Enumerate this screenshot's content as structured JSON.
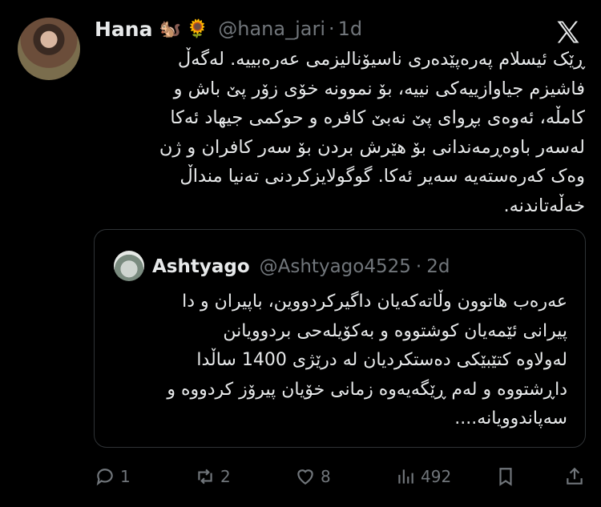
{
  "author": {
    "name": "Hana",
    "emojis": "🐿️ 🌻",
    "handle": "@hana_jari",
    "separator": "·",
    "time": "1d"
  },
  "tweet_lines": [
    "ڕێک ئیسلام پەرەپێدەری ناسیۆنالیزمی عەرەبییە. لەگەڵ",
    "فاشیزم جیاوازییەکی نییە، بۆ نموونە خۆی زۆر پێ باش و",
    "کامڵە، ئەوەی بڕوای پێ نەبێ کافرە و حوکمی جیهاد ئەکا",
    "لەسەر باوەڕمەندانی بۆ هێرش بردن بۆ سەر کافران و ژن",
    "وەک کەرەستەیە سەیر ئەکا. گوگولایزکردنی تەنیا منداڵ",
    "خەڵەتاندنە."
  ],
  "quote": {
    "name": "Ashtyago",
    "handle": "@Ashtyago4525",
    "separator": "·",
    "time": "2d",
    "lines": [
      "عەرەب هاتوون وڵاتەکەیان داگیرکردووین، باپیران و دا",
      "پیرانی ئێمەیان کوشتووە و بەکۆیلەحی بردوویانن",
      "لەولاوە کتێبێکی دەستکردیان لە درێژی 1400 ساڵدا",
      "داڕشتووە و لەم ڕێگەیەوە زمانی خۆیان پیرۆز کردووە و",
      "سەپاندوویانە...."
    ]
  },
  "actions": {
    "replies": "1",
    "retweets": "2",
    "likes": "8",
    "views": "492"
  }
}
